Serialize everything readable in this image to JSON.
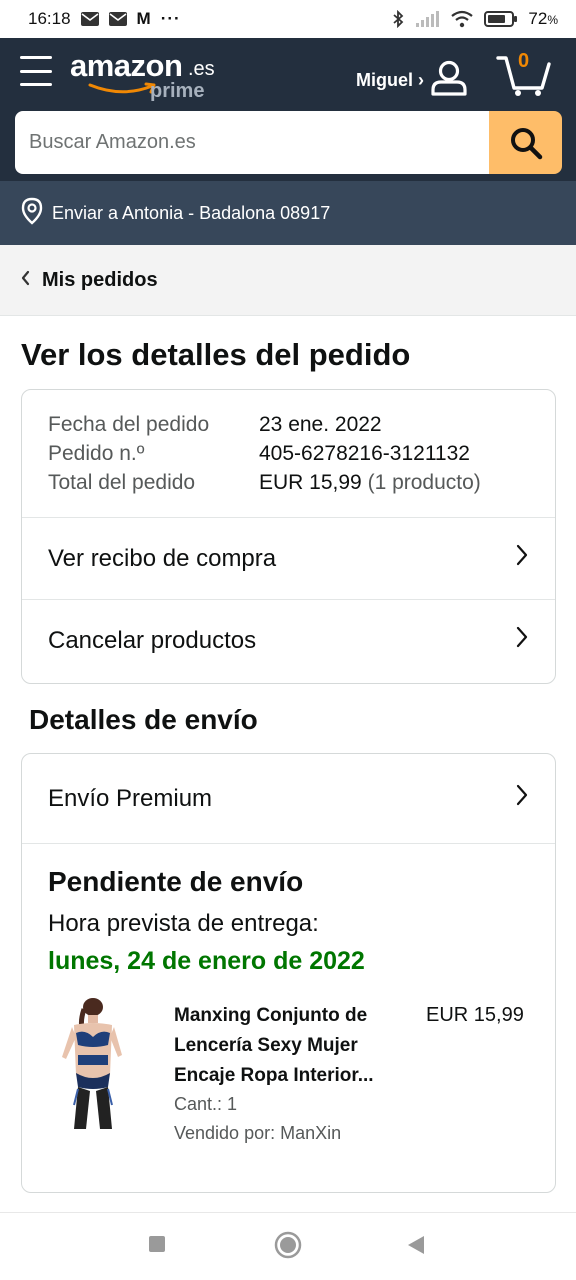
{
  "status_bar": {
    "time": "16:18",
    "battery": "72",
    "battery_unit": "%",
    "more": "···",
    "mail_glyph": "M"
  },
  "header": {
    "logo_word": "amazon",
    "logo_tld": ".es",
    "logo_prime": "prime",
    "account_label": "Miguel ›",
    "cart_count": "0",
    "search_placeholder": "Buscar Amazon.es"
  },
  "delivery": {
    "label": "Enviar a Antonia - Badalona 08917"
  },
  "breadcrumb": {
    "label": "Mis pedidos"
  },
  "page_title": "Ver los detalles del pedido",
  "order_summary": {
    "date_label": "Fecha del pedido",
    "date_value": "23 ene. 2022",
    "number_label": "Pedido n.º",
    "number_value": "405-6278216-3121132",
    "total_label": "Total del pedido",
    "total_value": "EUR 15,99",
    "total_count": "(1 producto)"
  },
  "actions": {
    "receipt": "Ver recibo de compra",
    "cancel": "Cancelar productos"
  },
  "shipping": {
    "section_title": "Detalles de envío",
    "method": "Envío Premium",
    "status": "Pendiente de envío",
    "eta_label": "Hora prevista de entrega:",
    "eta_date": "lunes, 24 de enero de 2022"
  },
  "product": {
    "name": "Manxing Conjunto de Lencería Sexy Mujer Encaje Ropa Interior...",
    "price": "EUR 15,99",
    "quantity": "Cant.: 1",
    "seller": "Vendido por: ManXin"
  },
  "colors": {
    "header_bg": "#232f3e",
    "delivery_bg": "#37475a",
    "search_button": "#febd69",
    "cart_count": "#f08804",
    "eta_green": "#007600"
  }
}
